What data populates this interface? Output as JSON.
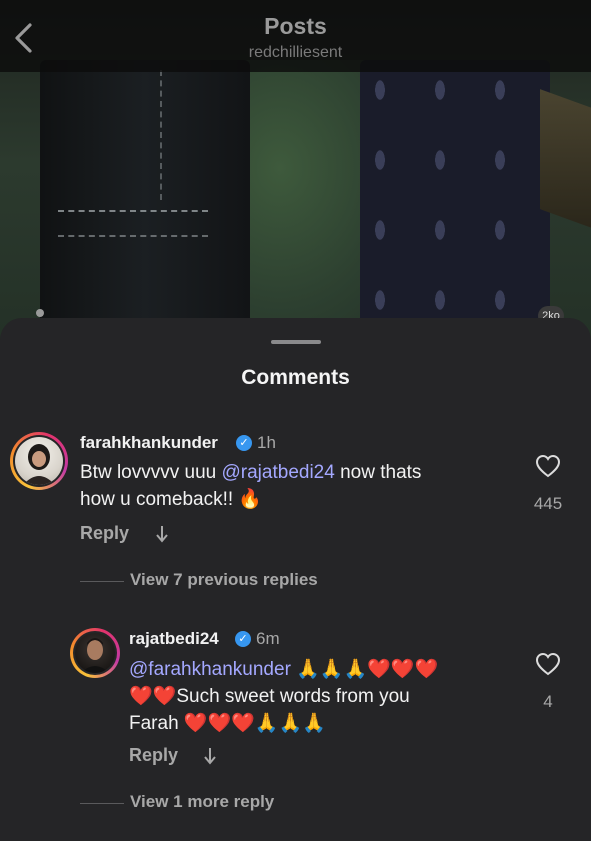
{
  "header": {
    "title": "Posts",
    "subtitle": "redchilliesent"
  },
  "photo": {
    "carousel_badge": "2ko"
  },
  "comments_sheet": {
    "title": "Comments"
  },
  "comments": [
    {
      "username": "farahkhankunder",
      "verified": true,
      "time": "1h",
      "text_before": "Btw lovvvvv uuu ",
      "mention": "@rajatbedi24",
      "text_after": " now thats",
      "line2": "how u comeback!!",
      "emoji_end": "🔥",
      "likes": "445",
      "reply_label": "Reply",
      "view_replies": "View 7 previous replies"
    },
    {
      "username": "rajatbedi24",
      "verified": true,
      "time": "6m",
      "mention": "@farahkhankunder",
      "emoji_line1": "🙏🙏🙏❤️❤️❤️",
      "emoji_line2_start": "❤️❤️",
      "text_line2": "Such sweet words from you",
      "text_line3": "Farah",
      "emoji_line3": "❤️❤️❤️🙏🙏🙏",
      "likes": "4",
      "reply_label": "Reply",
      "view_replies": "View 1 more reply"
    }
  ],
  "colors": {
    "sheet_bg": "#252527",
    "mention": "#a4a8ff",
    "verified": "#3797f0"
  }
}
